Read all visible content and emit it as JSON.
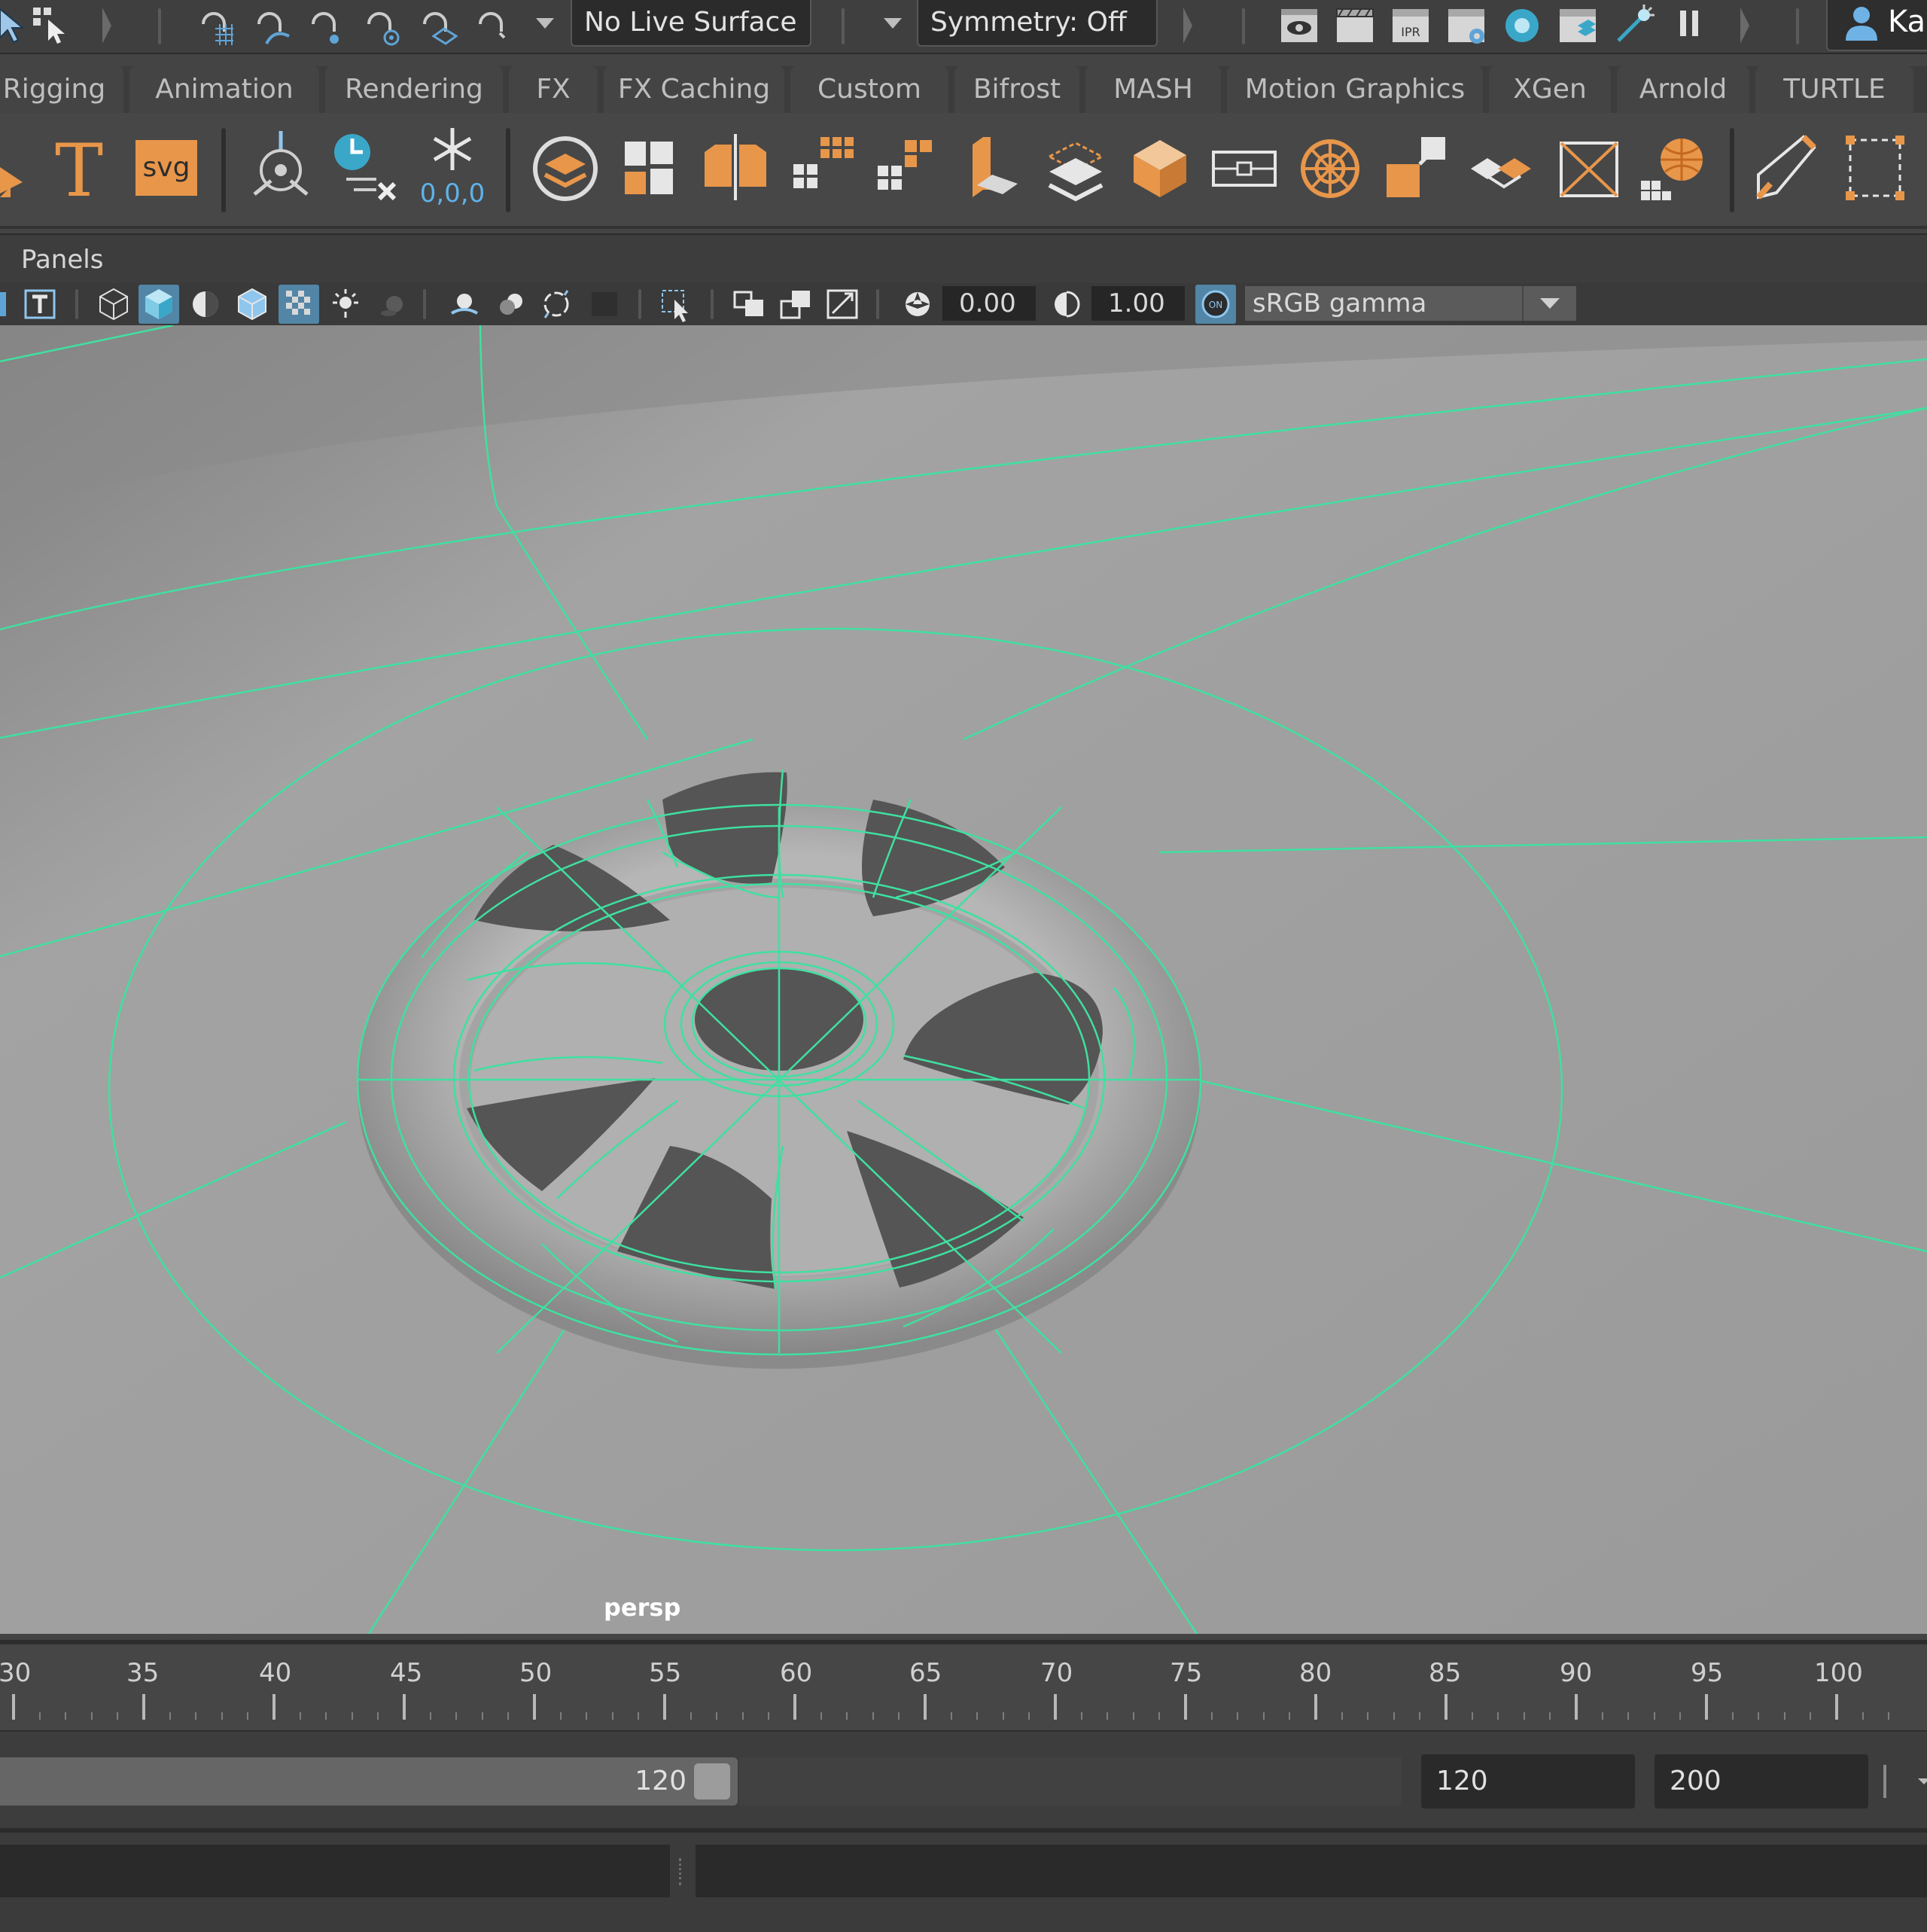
{
  "status_line": {
    "live_surface": "No Live Surface",
    "symmetry": "Symmetry: Off",
    "user_label": "Ka",
    "icons": [
      "select-tool-icon",
      "paint-select-icon",
      "snap-to-grids-icon",
      "snap-to-curves-icon",
      "snap-to-points-icon",
      "snap-to-projected-center-icon",
      "snap-to-view-planes-icon",
      "make-live-icon",
      "snap-menu-icon",
      "render-view-icon",
      "render-current-frame-icon",
      "ipr-render-icon",
      "render-settings-icon",
      "hypershade-icon",
      "render-setup-icon",
      "light-editor-icon",
      "pause-viewport-icon",
      "user-icon"
    ],
    "ipr_text": "IPR"
  },
  "shelf_tabs": [
    "Rigging",
    "Animation",
    "Rendering",
    "FX",
    "FX Caching",
    "Custom",
    "Bifrost",
    "MASH",
    "Motion Graphics",
    "XGen",
    "Arnold",
    "TURTLE"
  ],
  "shelf": {
    "text_tool_glyph": "T",
    "svg_tool_label": "svg",
    "freeze_label": "0,0,0",
    "icons": [
      "move-tool-icon",
      "type-tool-icon",
      "svg-tool-icon",
      "center-pivot-icon",
      "delete-history-icon",
      "freeze-transforms-icon",
      "make-layer-icon",
      "combine-icon",
      "mirror-icon",
      "extract-icon",
      "separate-icon",
      "smooth-icon",
      "extrude-icon",
      "bridge-icon",
      "bevel-icon",
      "multi-cut-icon",
      "sphere-uv-icon",
      "boolean-icon",
      "edge-loop-icon",
      "quad-draw-icon",
      "target-weld-icon",
      "cut-faces-icon",
      "sculpt-tool-icon",
      "bounding-box-icon"
    ]
  },
  "panel_menu": {
    "label": "Panels"
  },
  "panel_toolbar": {
    "exposure": "0.00",
    "gamma": "1.00",
    "color_space": "sRGB gamma",
    "icons": [
      "camera-attributes-icon",
      "text-overlay-icon",
      "wireframe-icon",
      "smooth-shade-icon",
      "default-material-icon",
      "wireframe-on-shaded-icon",
      "xray-icon",
      "use-lights-icon",
      "shadows-icon",
      "screen-space-ao-icon",
      "motion-blur-icon",
      "anti-aliasing-icon",
      "depth-of-field-icon",
      "isolate-select-icon",
      "xray-joints-icon",
      "grid-icon",
      "film-gate-icon",
      "resolution-gate-icon",
      "gate-mask-icon",
      "exposure-icon",
      "gamma-icon",
      "color-management-icon"
    ],
    "cm_label": "ON"
  },
  "viewport": {
    "camera": "persp",
    "wire_color": "#3fe0a0"
  },
  "time_slider": {
    "ticks": [
      30,
      35,
      40,
      45,
      50,
      55,
      60,
      65,
      70,
      75,
      80,
      85,
      90,
      95,
      100
    ]
  },
  "range_slider": {
    "end_value": "120",
    "playback_end": "120",
    "animation_end": "200"
  },
  "colors": {
    "accent_orange": "#e8964a",
    "active_blue": "#5285a6",
    "wireframe": "#3fe0a0"
  }
}
